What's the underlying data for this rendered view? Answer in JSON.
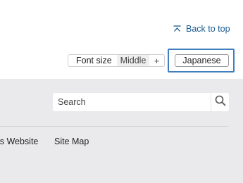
{
  "header": {
    "back_to_top": "Back to top",
    "font_size": {
      "label": "Font size",
      "value": "Middle",
      "increase": "+"
    },
    "language": "Japanese"
  },
  "footer": {
    "search": {
      "placeholder": "Search"
    },
    "links": [
      {
        "label": "his Website"
      },
      {
        "label": "Site Map"
      }
    ]
  },
  "colors": {
    "link": "#1a5a8c",
    "focus_ring": "#3f7fbf",
    "footer_bg": "#eaeaec"
  }
}
